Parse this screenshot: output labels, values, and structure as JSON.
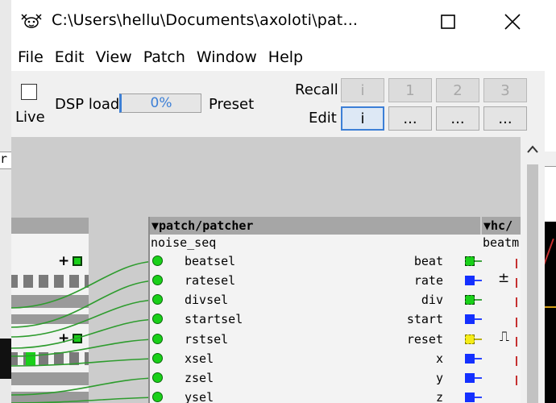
{
  "window": {
    "title": "C:\\Users\\hellu\\Documents\\axoloti\\pat...",
    "icons": {
      "app": "axoloti-icon",
      "maximize": "maximize-icon",
      "close": "close-icon"
    }
  },
  "menu": [
    "File",
    "Edit",
    "View",
    "Patch",
    "Window",
    "Help"
  ],
  "toolbar": {
    "live_label": "Live",
    "live_checked": false,
    "dsp_label": "DSP load",
    "dsp_value": "0%",
    "dsp_fraction": 0.0,
    "preset_label": "Preset",
    "recall_label": "Recall",
    "edit_label": "Edit",
    "recall_buttons": [
      "i",
      "1",
      "2",
      "3"
    ],
    "edit_buttons": [
      "i",
      "...",
      "...",
      "..."
    ]
  },
  "background_windows": {
    "left_char": "r"
  },
  "canvas": {
    "left_object": {
      "plus1": "+",
      "plus2": "+"
    },
    "patcher": {
      "type": "▼patch/patcher",
      "name": "noise_seq",
      "inlets": [
        "beatsel",
        "ratesel",
        "divsel",
        "startsel",
        "rstsel",
        "xsel",
        "zsel",
        "ysel"
      ],
      "outlets": [
        "beat",
        "rate",
        "div",
        "start",
        "reset",
        "x",
        "y",
        "z"
      ]
    },
    "right_object": {
      "type": "▼hc/",
      "name": "beatm",
      "symbols": [
        "±",
        "⎍"
      ]
    }
  },
  "colors": {
    "canvas": "#cccccc",
    "object_header": "#a6a6a6",
    "bool_green": "#19d019",
    "frac_blue": "#1430ff",
    "int_yellow": "#f5ec17",
    "wire_green": "#2e9c2e",
    "selection_blue": "#3c7fd6"
  }
}
